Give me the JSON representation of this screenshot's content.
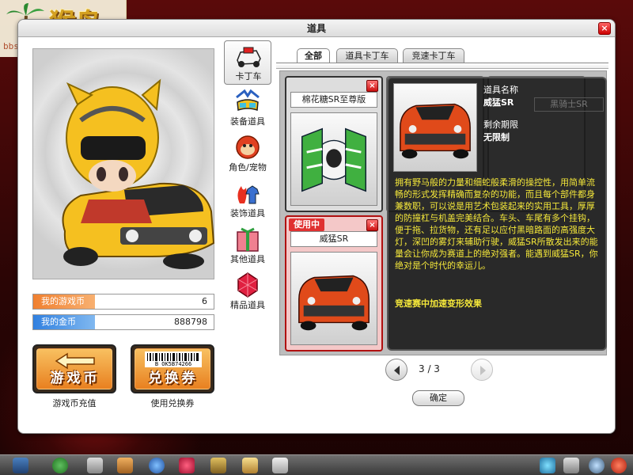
{
  "watermark": {
    "logo_text": "猴岛",
    "url": "bbs.houdao.com"
  },
  "window": {
    "title": "道具",
    "close_label": "×"
  },
  "stats": {
    "game_coins_label": "我的游戏币",
    "game_coins_value": "6",
    "gold_label": "我的金币",
    "gold_value": "888798"
  },
  "buttons": {
    "recharge_text": "游戏币",
    "recharge_caption": "游戏币充值",
    "voucher_text": "兑换券",
    "voucher_caption": "使用兑换券",
    "voucher_barcode": "B OK5B74266"
  },
  "categories": [
    {
      "label": "卡丁车",
      "icon": "kart-icon",
      "active": true
    },
    {
      "label": "装备道具",
      "icon": "goggles-icon"
    },
    {
      "label": "角色/宠物",
      "icon": "monkey-face-icon"
    },
    {
      "label": "装饰道具",
      "icon": "flame-shirt-icon"
    },
    {
      "label": "其他道具",
      "icon": "gift-box-icon"
    },
    {
      "label": "精品道具",
      "icon": "gem-icon"
    }
  ],
  "tabs": [
    {
      "label": "全部",
      "active": true
    },
    {
      "label": "道具卡丁车"
    },
    {
      "label": "竞速卡丁车"
    }
  ],
  "items": [
    {
      "name": "棉花糖SR至尊版",
      "close": "×"
    },
    {
      "name": "威猛SR",
      "badge": "使用中",
      "close": "×"
    }
  ],
  "tooltip": {
    "name_key": "道具名称",
    "name_value": "威猛SR",
    "expiry_key": "剩余期限",
    "expiry_value": "无限制",
    "behind_name": "黑骑士SR",
    "description": "拥有野马般的力量和细蛇般柔滑的操控性，用简单流畅的形式发挥精确而复杂的功能，而且每个部件都身兼数职，可以说是用艺术包装起来的实用工具，厚厚的防撞杠与机盖完美结合。车头、车尾有多个挂钩，便于拖、拉货物，还有足以应付黑暗路面的高强度大灯，深凹的雾灯来辅助行驶，威猛SR所散发出来的能量会让你成为赛道上的绝对强者。能遇到威猛SR，你绝对是个时代的幸运儿。",
    "effect": "竞速赛中加速变形效果"
  },
  "pagination": {
    "indicator": "3 / 3"
  },
  "confirm_label": "确定",
  "colors": {
    "accent_orange": "#f08030",
    "accent_blue": "#3080e0",
    "in_use_red": "#e03030",
    "tooltip_text": "#f5e83a"
  },
  "taskbar_icons": [
    "home-icon",
    "back-arrow-icon",
    "cart-icon",
    "character-icon",
    "potion-icon",
    "heart-icon",
    "tools-icon",
    "wing-icon",
    "book-icon",
    "paw-icon",
    "settings-icon",
    "search-icon",
    "power-icon"
  ]
}
